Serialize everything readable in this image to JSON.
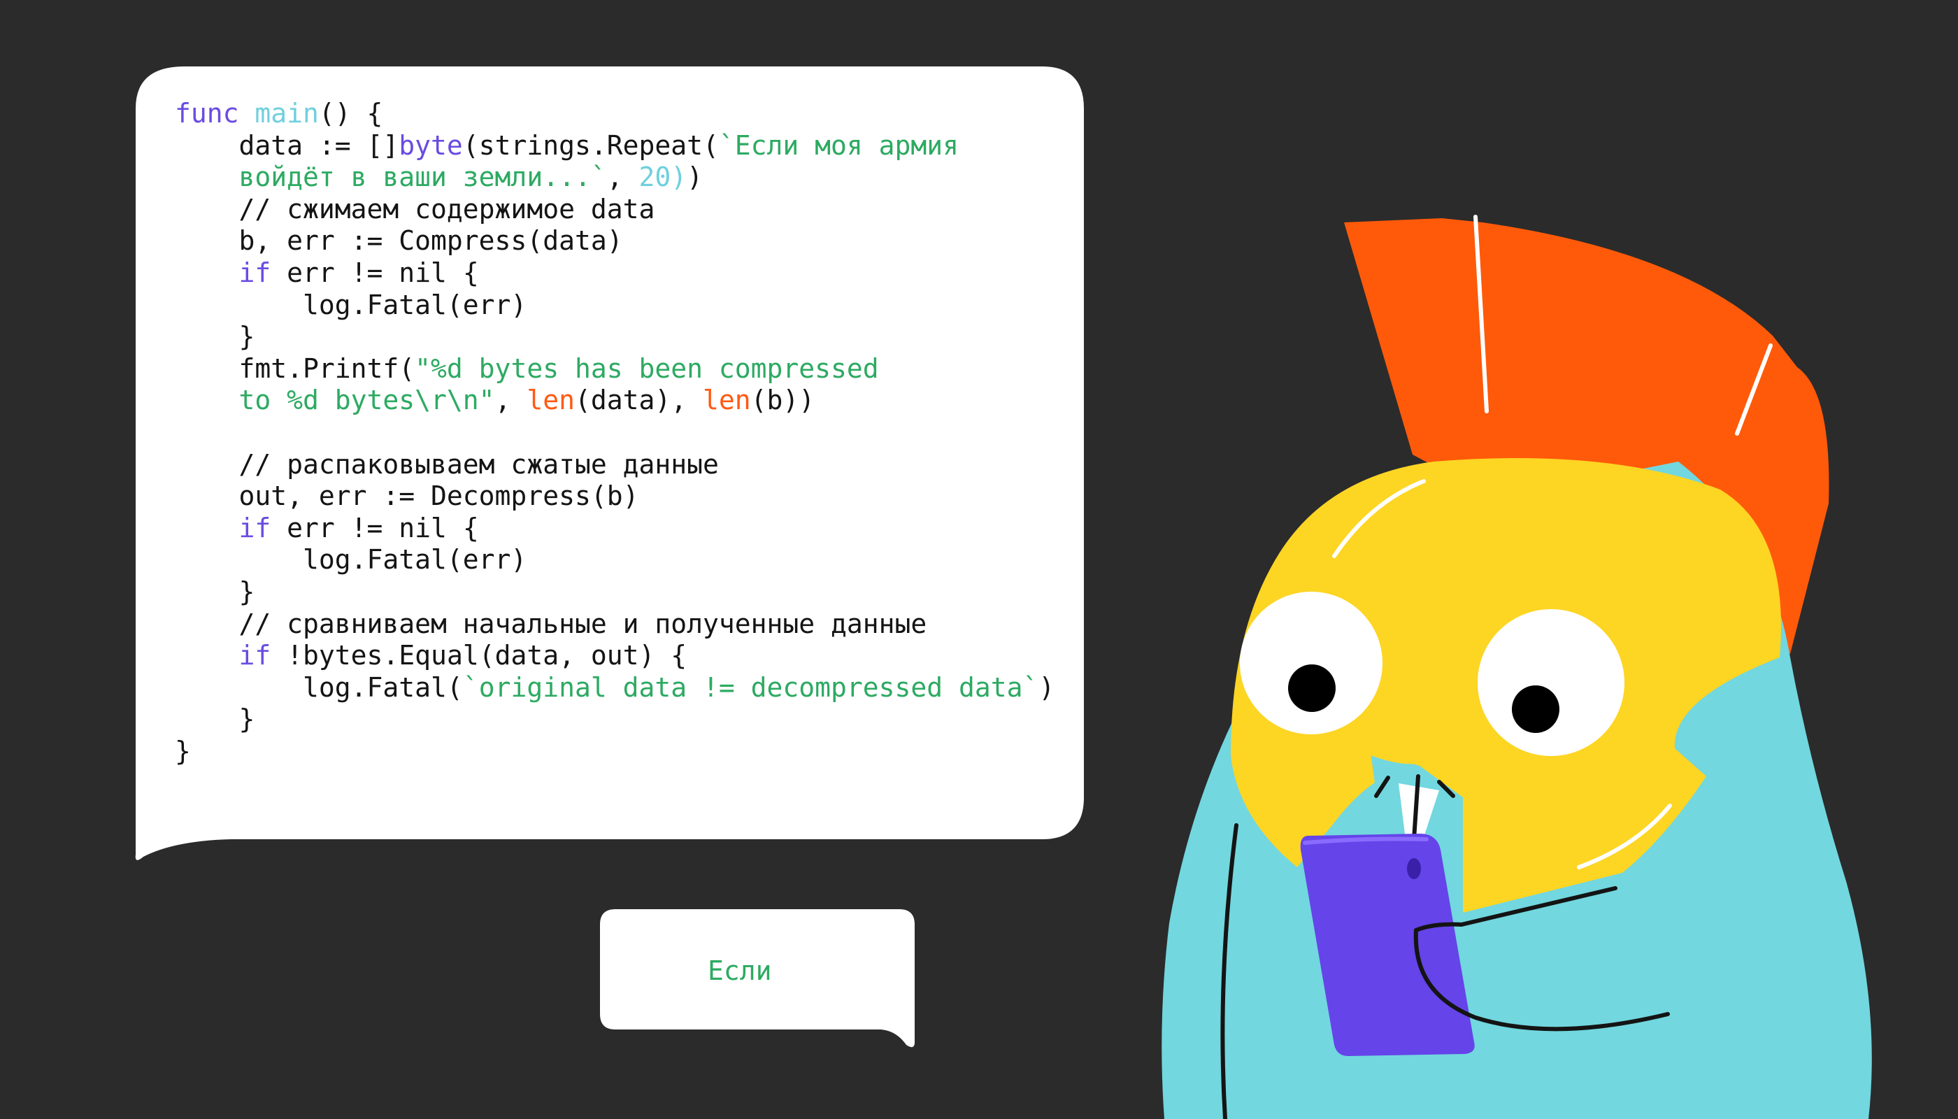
{
  "code": {
    "lines": [
      [
        {
          "t": "func",
          "c": "kw"
        },
        {
          "t": " ",
          "c": ""
        },
        {
          "t": "main",
          "c": "fn"
        },
        {
          "t": "() {",
          "c": ""
        }
      ],
      [
        {
          "t": "    data := []",
          "c": ""
        },
        {
          "t": "byte",
          "c": "kw"
        },
        {
          "t": "(strings.Repeat(",
          "c": ""
        },
        {
          "t": "`Если моя армия",
          "c": "str"
        }
      ],
      [
        {
          "t": "    войдёт в ваши земли...`",
          "c": "str"
        },
        {
          "t": ", ",
          "c": ""
        },
        {
          "t": "20",
          "c": "num"
        },
        {
          "t": ")",
          "c": "num"
        },
        {
          "t": ")",
          "c": ""
        }
      ],
      [
        {
          "t": "    // сжимаем содержимое data",
          "c": ""
        }
      ],
      [
        {
          "t": "    b, err := Compress(data)",
          "c": ""
        }
      ],
      [
        {
          "t": "    ",
          "c": ""
        },
        {
          "t": "if",
          "c": "kw"
        },
        {
          "t": " err != nil {",
          "c": ""
        }
      ],
      [
        {
          "t": "        log.Fatal(err)",
          "c": ""
        }
      ],
      [
        {
          "t": "    }",
          "c": ""
        }
      ],
      [
        {
          "t": "    fmt.Printf(",
          "c": ""
        },
        {
          "t": "\"%d bytes has been compressed",
          "c": "str"
        }
      ],
      [
        {
          "t": "    to %d bytes\\r\\n\"",
          "c": "str"
        },
        {
          "t": ", ",
          "c": ""
        },
        {
          "t": "len",
          "c": "bi"
        },
        {
          "t": "(data), ",
          "c": ""
        },
        {
          "t": "len",
          "c": "bi"
        },
        {
          "t": "(b))",
          "c": ""
        }
      ],
      [
        {
          "t": "",
          "c": ""
        }
      ],
      [
        {
          "t": "    // распаковываем сжатые данные",
          "c": ""
        }
      ],
      [
        {
          "t": "    out, err := Decompress(b)",
          "c": ""
        }
      ],
      [
        {
          "t": "    ",
          "c": ""
        },
        {
          "t": "if",
          "c": "kw"
        },
        {
          "t": " err != nil {",
          "c": ""
        }
      ],
      [
        {
          "t": "        log.Fatal(err)",
          "c": ""
        }
      ],
      [
        {
          "t": "    }",
          "c": ""
        }
      ],
      [
        {
          "t": "    // сравниваем начальные и полученные данные",
          "c": ""
        }
      ],
      [
        {
          "t": "    ",
          "c": ""
        },
        {
          "t": "if",
          "c": "kw"
        },
        {
          "t": " !bytes.Equal(data, out) {",
          "c": ""
        }
      ],
      [
        {
          "t": "        log.Fatal(",
          "c": ""
        },
        {
          "t": "`original data != decompressed data`",
          "c": "str"
        },
        {
          "t": ")",
          "c": ""
        }
      ],
      [
        {
          "t": "    }",
          "c": ""
        }
      ],
      [
        {
          "t": "}",
          "c": ""
        }
      ]
    ]
  },
  "reply": {
    "text": "Если"
  },
  "colors": {
    "background": "#2b2b2b",
    "bubble": "#ffffff",
    "keyword": "#6a4ce0",
    "function_name": "#6fd0de",
    "string": "#2daa62",
    "builtin": "#ff5a13",
    "body": "#72d7df",
    "helmet": "#fdd523",
    "crest": "#ff5a0a",
    "phone": "#6544e9"
  },
  "icons": {
    "character": "gopher-spartan-helmet-icon",
    "phone": "smartphone-icon"
  }
}
